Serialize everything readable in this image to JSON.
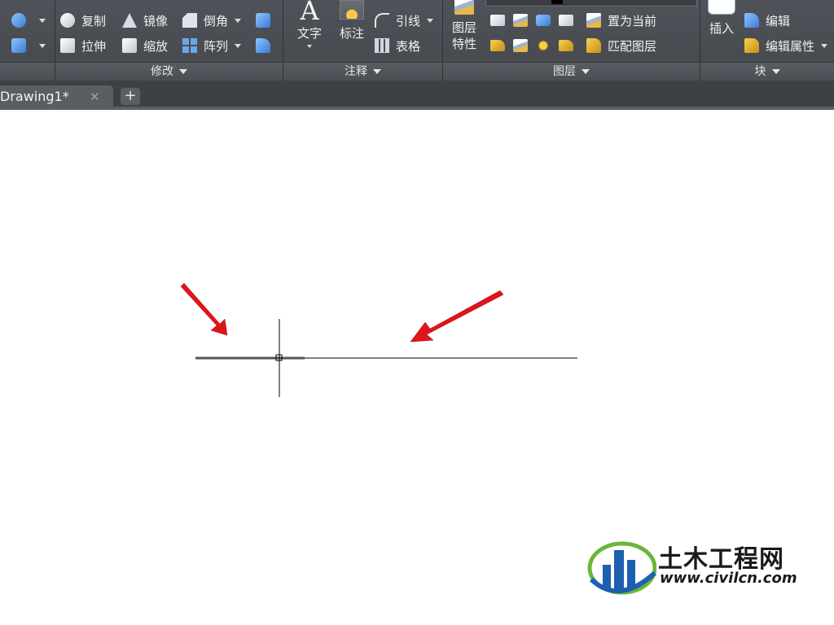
{
  "ribbon": {
    "panels": {
      "modify": {
        "title": "修改"
      },
      "annotation": {
        "title": "注释"
      },
      "layers": {
        "title": "图层"
      },
      "block": {
        "title": "块"
      }
    },
    "modify_tools": {
      "copy": "复制",
      "mirror": "镜像",
      "fillet": "倒角",
      "stretch": "拉伸",
      "scale": "缩放",
      "array": "阵列"
    },
    "annotation_tools": {
      "text": "文字",
      "dimension": "标注",
      "leader": "引线",
      "table": "表格"
    },
    "layer_tools": {
      "layer_props_line1": "图层",
      "layer_props_line2": "特性",
      "make_current": "置为当前",
      "match_layer": "匹配图层"
    },
    "block_tools": {
      "insert": "插入",
      "edit": "编辑",
      "edit_attributes": "编辑属性"
    }
  },
  "tabs": {
    "active": "Drawing1*",
    "close_glyph": "✕",
    "add_glyph": "+"
  },
  "watermark": {
    "title": "土木工程网",
    "url": "www.civilcn.com"
  },
  "colors": {
    "ribbon_bg": "#4a4e53",
    "arrow_red": "#e0141b",
    "logo_blue": "#1d5fb0",
    "logo_green": "#6ab63a"
  }
}
